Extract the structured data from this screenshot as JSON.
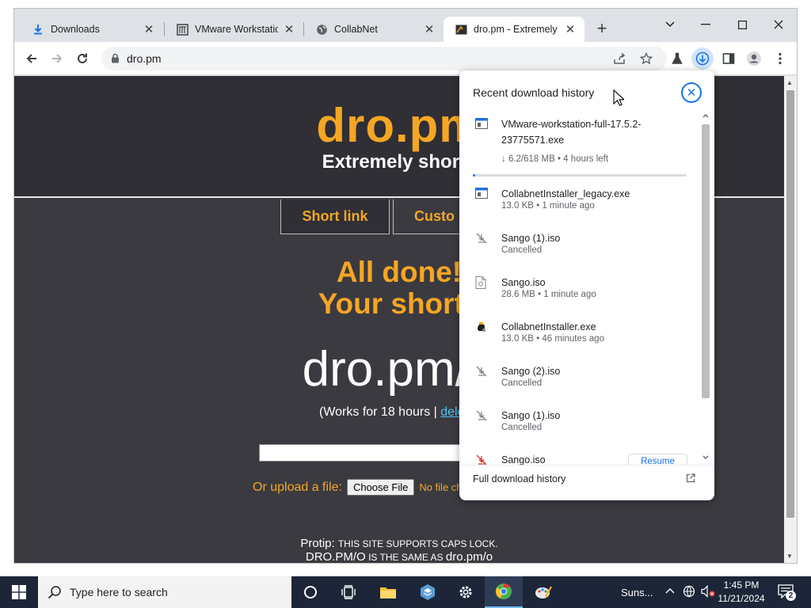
{
  "browser": {
    "tabs": [
      {
        "title": "Downloads",
        "icon": "download-icon"
      },
      {
        "title": "VMware Workstation",
        "icon": "vmware-icon"
      },
      {
        "title": "CollabNet",
        "icon": "globe-icon"
      },
      {
        "title": "dro.pm - Extremely S",
        "icon": "dro-favicon"
      }
    ],
    "active_tab": 3,
    "address": "dro.pm"
  },
  "page": {
    "title": "dro.pm",
    "tagline": "Extremely short l",
    "nav": [
      "Short link",
      "Custo"
    ],
    "done_line1": "All done!",
    "done_line2": "Your short l",
    "short_url": "dro.pm/a",
    "works_prefix": "(Works for 18 hours | ",
    "works_link": "dele",
    "upload_label": "Or upload a file:",
    "choose_file": "Choose File",
    "no_file": "No file ch",
    "protip_1a": "Protip: ",
    "protip_1b": "THIS SITE SUPPORTS CAPS LOCK.",
    "protip_2a": "DRO.PM/O",
    "protip_2b": " IS THE SAME AS ",
    "protip_2c": "dro.pm/o"
  },
  "downloads": {
    "heading": "Recent download history",
    "items": [
      {
        "name": "VMware-workstation-full-17.5.2-23775571.exe",
        "status": "↓ 6.2/618 MB • 4 hours left",
        "icon": "exe-file-icon",
        "progress": 0.01
      },
      {
        "name": "CollabnetInstaller_legacy.exe",
        "status": "13.0 KB • 1 minute ago",
        "icon": "exe-file-icon"
      },
      {
        "name": "Sango (1).iso",
        "status": "Cancelled",
        "icon": "cancelled-download-icon"
      },
      {
        "name": "Sango.iso",
        "status": "28.6 MB • 1 minute ago",
        "icon": "file-icon"
      },
      {
        "name": "CollabnetInstaller.exe",
        "status": "13.0 KB • 46 minutes ago",
        "icon": "installer-icon"
      },
      {
        "name": "Sango (2).iso",
        "status": "Cancelled",
        "icon": "cancelled-download-icon"
      },
      {
        "name": "Sango (1).iso",
        "status": "Cancelled",
        "icon": "cancelled-download-icon"
      },
      {
        "name": "Sango.iso",
        "status": "",
        "icon": "cancelled-download-icon"
      }
    ],
    "resume_label": "Resume",
    "full_history": "Full download history"
  },
  "taskbar": {
    "search_placeholder": "Type here to search",
    "weather": "Suns...",
    "time": "1:45 PM",
    "date": "11/21/2024",
    "notification_count": "2"
  }
}
